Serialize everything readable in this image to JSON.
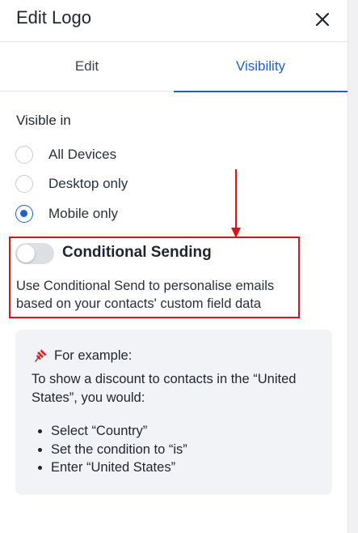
{
  "header": {
    "title": "Edit Logo",
    "close_icon": "close-icon"
  },
  "tabs": [
    {
      "label": "Edit",
      "active": false
    },
    {
      "label": "Visibility",
      "active": true
    }
  ],
  "visibility": {
    "label": "Visible in",
    "options": [
      {
        "label": "All Devices",
        "selected": false
      },
      {
        "label": "Desktop only",
        "selected": false
      },
      {
        "label": "Mobile only",
        "selected": true
      }
    ]
  },
  "conditional": {
    "title": "Conditional Sending",
    "enabled": false,
    "description": "Use Conditional Send to personalise emails based on your contacts' custom field data"
  },
  "example": {
    "icon": "pushpin-icon",
    "heading": "For example:",
    "body": "To show a discount to contacts in the “United States”, you would:",
    "steps": [
      "Select “Country”",
      "Set the condition to “is”",
      "Enter “United States”"
    ]
  },
  "colors": {
    "accent": "#1f5fd1",
    "annotation": "#e0101a",
    "example_bg": "#f2f3f6"
  }
}
